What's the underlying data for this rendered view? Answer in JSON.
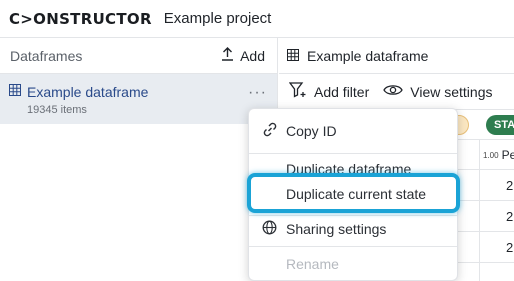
{
  "topbar": {
    "logo": "C>ONSTRUCTOR",
    "project_name": "Example project"
  },
  "sidebar": {
    "header_label": "Dataframes",
    "add_label": "Add",
    "items": [
      {
        "name": "Example dataframe",
        "count": "19345 items",
        "more": "···"
      }
    ]
  },
  "main": {
    "tab_label": "Example dataframe",
    "toolbar": {
      "add_filter": "Add filter",
      "view_settings": "View settings"
    },
    "chip_status": "STAT",
    "column_type": "1.00",
    "column_name": "Pe",
    "cell_values": [
      "2",
      "2",
      "2"
    ]
  },
  "context_menu": {
    "items": [
      {
        "label": "Copy ID",
        "icon": "link-icon",
        "disabled": false
      },
      {
        "label": "Duplicate dataframe",
        "icon": "",
        "disabled": false
      },
      {
        "label": "Duplicate current state",
        "icon": "",
        "disabled": false,
        "highlighted": true
      },
      {
        "label": "Sharing settings",
        "icon": "globe-icon",
        "disabled": false
      },
      {
        "label": "Rename",
        "icon": "",
        "disabled": true
      }
    ]
  },
  "colors": {
    "highlight": "#1aa3d6",
    "status_chip": "#2e7d4f",
    "selected_row": "#e8ecf1",
    "link_text": "#2a4a8a"
  }
}
